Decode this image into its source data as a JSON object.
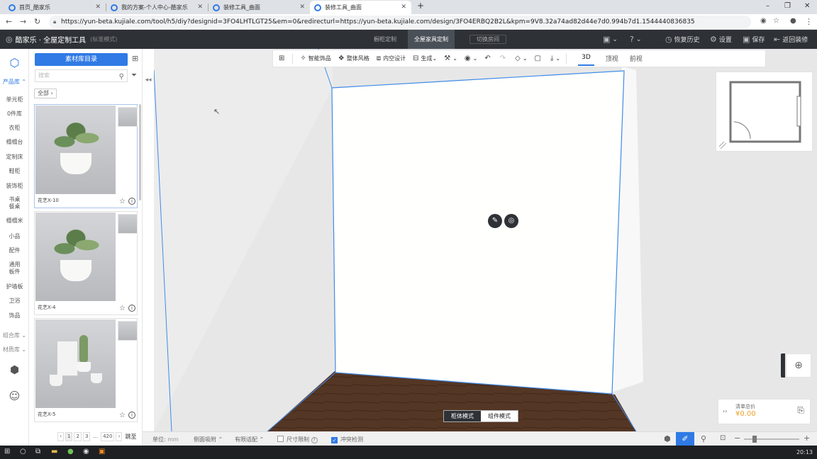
{
  "browser": {
    "tabs": [
      {
        "title": "首页_酷家乐",
        "active": false
      },
      {
        "title": "我的方案-个人中心-酷家乐",
        "active": false
      },
      {
        "title": "装修工具_曲面",
        "active": false
      },
      {
        "title": "装修工具_曲面",
        "active": true
      }
    ],
    "new_tab": "+",
    "url": "https://yun-beta.kujiale.com/tool/h5/diy?designid=3FO4LHTLGT25&em=0&redirecturl=https://yun-beta.kujiale.com/design/3FO4ERBQ2B2L&kpm=9V8.32a74ad82d44e7d0.994b7d1.1544440836835"
  },
  "header": {
    "logo": "酷家乐 · 全屋定制工具",
    "mode": "(标准模式)",
    "nav": [
      "橱柜定制",
      "全屋家具定制",
      "切换房间"
    ],
    "active_nav": "全屋家具定制",
    "actions": {
      "history": "恢复历史",
      "settings": "设置",
      "save": "保存",
      "back": "返回装修"
    }
  },
  "rail": {
    "product_lib": "产品库",
    "categories": [
      "单元柜",
      "0件库",
      "衣柜",
      "榻榻台",
      "定制床",
      "鞋柜",
      "装饰柜",
      "书桌\n餐桌",
      "榻榻米",
      "小品",
      "配件",
      "通用\n板件",
      "护墙板",
      "卫浴",
      "饰品"
    ],
    "combo_lib": "组合库",
    "material_lib": "材质库"
  },
  "panel": {
    "catalog_button": "素材库目录",
    "search_placeholder": "搜索",
    "all_filter": "全部",
    "products": [
      {
        "name": "花艺X-10"
      },
      {
        "name": "花艺X-4"
      },
      {
        "name": "花艺X-5"
      }
    ],
    "pager": {
      "pages": [
        "1",
        "2",
        "3",
        "...",
        "420"
      ],
      "jump": "跳至"
    }
  },
  "toolbar": {
    "items": [
      "智能饰品",
      "整体风格",
      "内空设计",
      "生成"
    ],
    "views": [
      "3D",
      "顶视",
      "前视"
    ],
    "active_view": "3D"
  },
  "canvas": {
    "modes": [
      "柜体模式",
      "组件模式"
    ],
    "active_mode": "柜体模式",
    "price_label": "清单总价",
    "price_value": "¥0.00"
  },
  "status": {
    "unit_label": "单位:",
    "unit_value": "mm",
    "side_snap": "侧面吸附",
    "limited_fit": "有限适配",
    "size_limit": "尺寸限制",
    "collision": "冲突检测",
    "collision_checked": true,
    "size_limit_checked": false
  },
  "taskbar": {
    "time": "20:13"
  }
}
